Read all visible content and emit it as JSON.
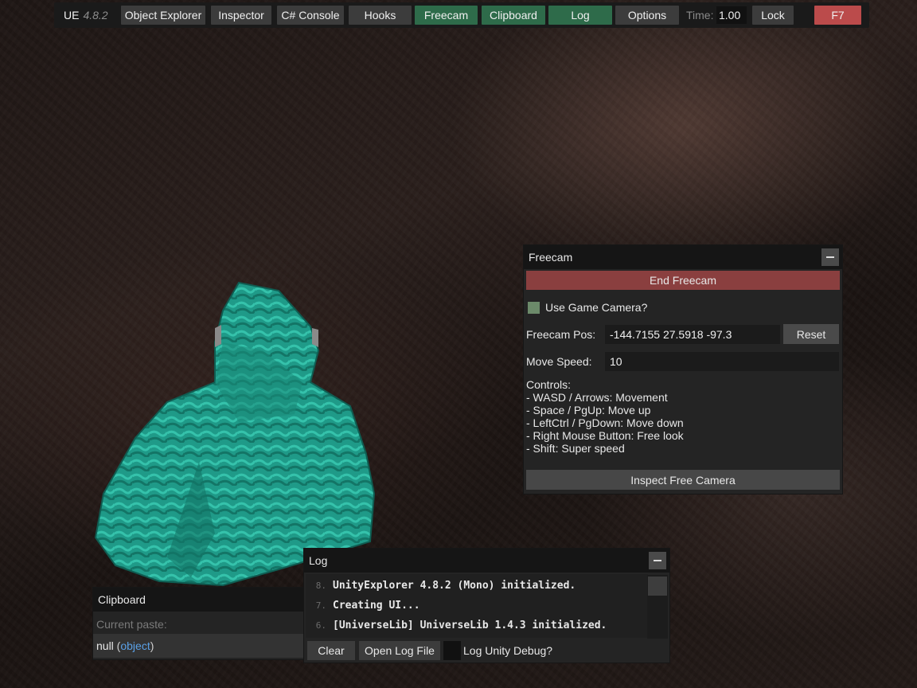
{
  "navbar": {
    "ue": "UE",
    "version": "4.8.2",
    "items": [
      {
        "label": "Object Explorer",
        "active": false
      },
      {
        "label": "Inspector",
        "active": false
      },
      {
        "label": "C# Console",
        "active": false
      },
      {
        "label": "Hooks",
        "active": false
      },
      {
        "label": "Freecam",
        "active": true
      },
      {
        "label": "Clipboard",
        "active": true
      },
      {
        "label": "Log",
        "active": true
      },
      {
        "label": "Options",
        "active": false
      }
    ],
    "time_label": "Time:",
    "time_value": "1.00",
    "lock_label": "Lock",
    "toggle_label": "F7"
  },
  "freecam": {
    "title": "Freecam",
    "end_button": "End Freecam",
    "use_game_camera_label": "Use Game Camera?",
    "use_game_camera_checked": true,
    "pos_label": "Freecam Pos:",
    "pos_value": "-144.7155 27.5918 -97.3",
    "reset_button": "Reset",
    "speed_label": "Move Speed:",
    "speed_value": "10",
    "controls": [
      "Controls:",
      "- WASD / Arrows: Movement",
      "- Space / PgUp: Move up",
      "- LeftCtrl / PgDown: Move down",
      "- Right Mouse Button: Free look",
      "- Shift: Super speed"
    ],
    "inspect_button": "Inspect Free Camera"
  },
  "clipboard": {
    "title": "Clipboard",
    "current_label": "Current paste:",
    "value_null": "null",
    "value_open": " (",
    "value_type": "object",
    "value_close": ")"
  },
  "log": {
    "title": "Log",
    "lines": [
      {
        "num": "8.",
        "text": "UnityExplorer 4.8.2 (Mono) initialized."
      },
      {
        "num": "7.",
        "text": "Creating UI..."
      },
      {
        "num": "6.",
        "text": "[UniverseLib] UniverseLib 1.4.3 initialized."
      }
    ],
    "clear_button": "Clear",
    "open_file_button": "Open Log File",
    "debug_label": "Log Unity Debug?"
  },
  "colors": {
    "active_tab": "#2e6b4a",
    "f7_button": "#bb4b4b",
    "end_freecam": "#8a3f3f",
    "checkbox": "#6c8a6a",
    "character": "#1f9e8c"
  }
}
